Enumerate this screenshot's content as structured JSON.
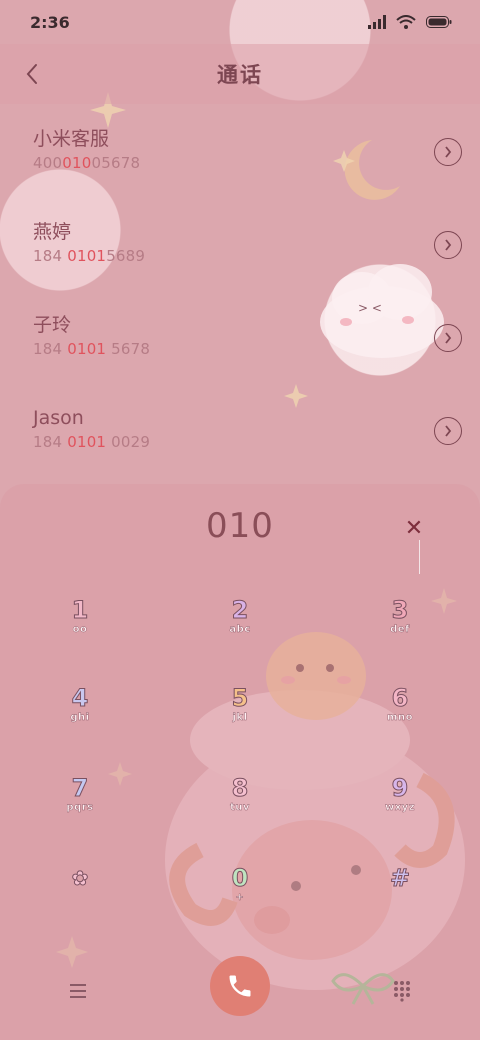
{
  "status_bar": {
    "time": "2:36"
  },
  "header": {
    "title": "通话"
  },
  "contacts": [
    {
      "name": "小米客服",
      "number_pre": "400",
      "number_match": "010",
      "number_post": "05678"
    },
    {
      "name": "燕婷",
      "number_pre": "184 ",
      "number_match": "0101",
      "number_post": "5689"
    },
    {
      "name": "子玲",
      "number_pre": "184 ",
      "number_match": "0101",
      "number_post": " 5678"
    },
    {
      "name": "Jason",
      "number_pre": "184 ",
      "number_match": "0101",
      "number_post": " 0029"
    }
  ],
  "dialpad": {
    "input": "010",
    "delete_icon": "delete-icon",
    "keys": [
      {
        "digit": "1",
        "letters": "oo",
        "color": "#f2b8c8"
      },
      {
        "digit": "2",
        "letters": "abc",
        "color": "#d9b2e6"
      },
      {
        "digit": "3",
        "letters": "def",
        "color": "#f0a8b8"
      },
      {
        "digit": "4",
        "letters": "ghi",
        "color": "#c9c7ee"
      },
      {
        "digit": "5",
        "letters": "jkl",
        "color": "#f5c08a"
      },
      {
        "digit": "6",
        "letters": "mno",
        "color": "#f4b6c6"
      },
      {
        "digit": "7",
        "letters": "pqrs",
        "color": "#c4c8f0"
      },
      {
        "digit": "8",
        "letters": "tuv",
        "color": "#f5c0cf"
      },
      {
        "digit": "9",
        "letters": "wxyz",
        "color": "#d7b6ea"
      },
      {
        "digit": "✿",
        "letters": "",
        "color": "#f5c0cf"
      },
      {
        "digit": "0",
        "letters": "+",
        "color": "#bfe3c0"
      },
      {
        "digit": "#",
        "letters": "",
        "color": "#cfc2f0"
      }
    ]
  },
  "colors": {
    "accent_call": "#e07f74",
    "match_highlight": "#e0535d"
  }
}
